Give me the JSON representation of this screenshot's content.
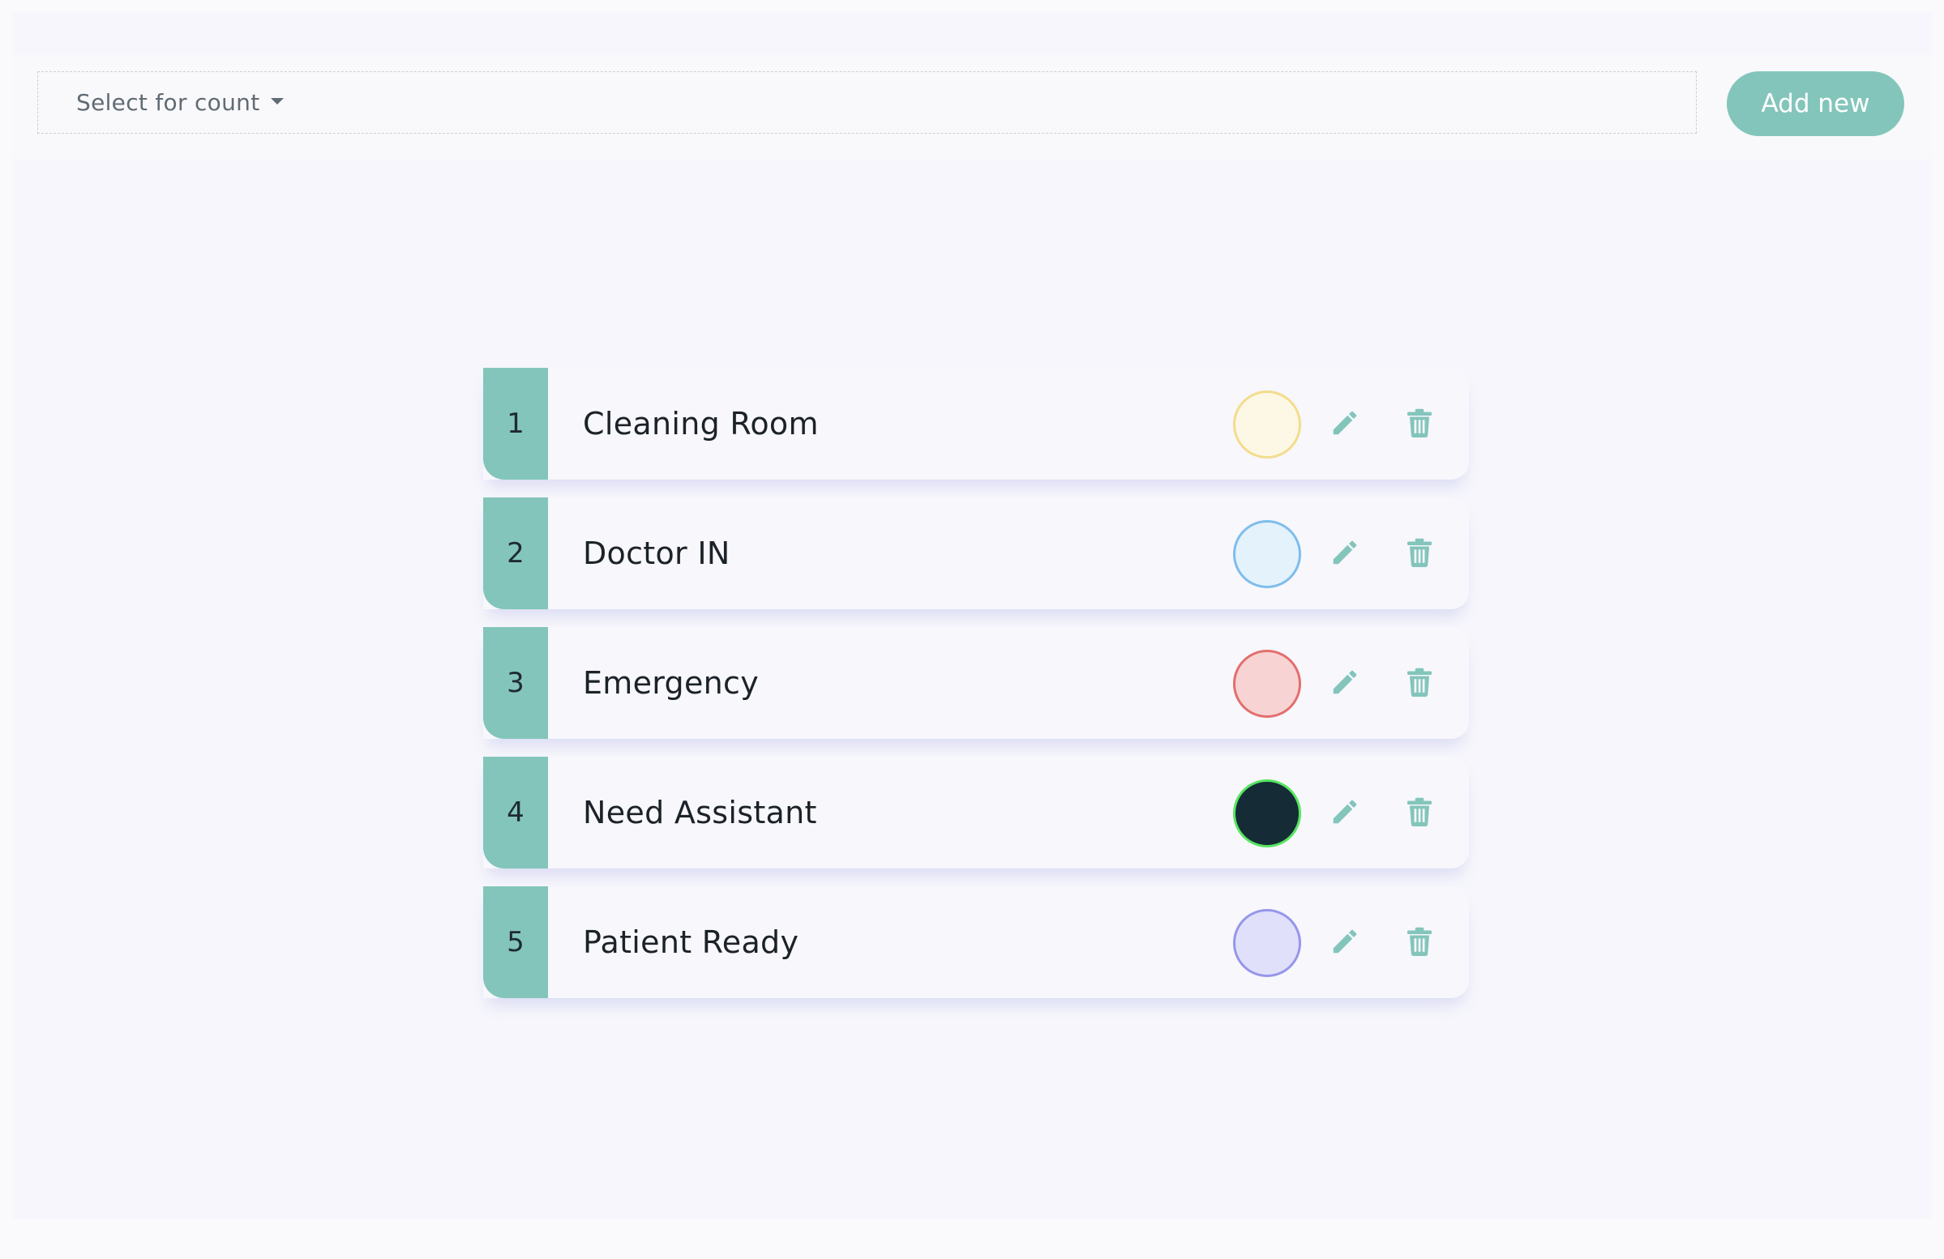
{
  "toolbar": {
    "count_select": {
      "selected_label": "Select for count"
    },
    "add_button_label": "Add new"
  },
  "colors": {
    "accent": "#83c5bb",
    "panel_background": "#f6f6fc",
    "text": "#1b2228"
  },
  "items": [
    {
      "index": "1",
      "name": "Cleaning Room",
      "swatch_fill": "#fdf8e6",
      "swatch_border": "#f3dc8c"
    },
    {
      "index": "2",
      "name": "Doctor IN",
      "swatch_fill": "#e4f2fb",
      "swatch_border": "#7ebdec"
    },
    {
      "index": "3",
      "name": "Emergency",
      "swatch_fill": "#f8d3d3",
      "swatch_border": "#e36e6e"
    },
    {
      "index": "4",
      "name": "Need Assistant",
      "swatch_fill": "#152b36",
      "swatch_border": "#57e55f"
    },
    {
      "index": "5",
      "name": "Patient Ready",
      "swatch_fill": "#e0e0fb",
      "swatch_border": "#9696ea"
    }
  ],
  "icons": {
    "edit": "pencil-icon",
    "delete": "trash-icon",
    "dropdown": "caret-down-icon"
  }
}
